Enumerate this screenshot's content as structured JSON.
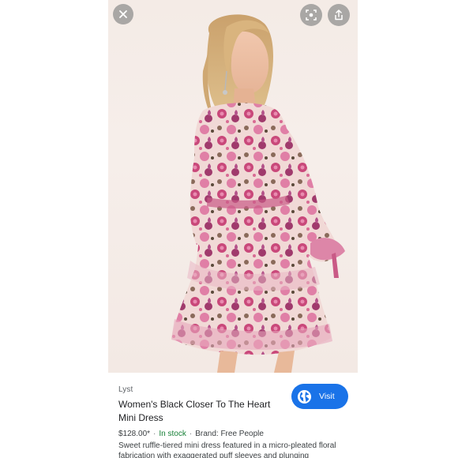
{
  "viewer": {
    "close_icon": "close-icon",
    "lens_icon": "lens-icon",
    "share_icon": "share-icon"
  },
  "result": {
    "source": "Lyst",
    "title": "Women's Black Closer To The Heart Mini Dress",
    "visit_label": "Visit",
    "visit_icon": "globe-icon",
    "price": "$128.00*",
    "stock": "In stock",
    "brand": "Brand: Free People",
    "description": "Sweet ruffle-tiered mini dress featured in a micro-pleated floral fabrication with exaggerated puff sleeves and plunging",
    "colors": {
      "accent": "#1a73e8",
      "stock": "#188038",
      "text": "#202124",
      "muted": "#5f6368"
    }
  }
}
